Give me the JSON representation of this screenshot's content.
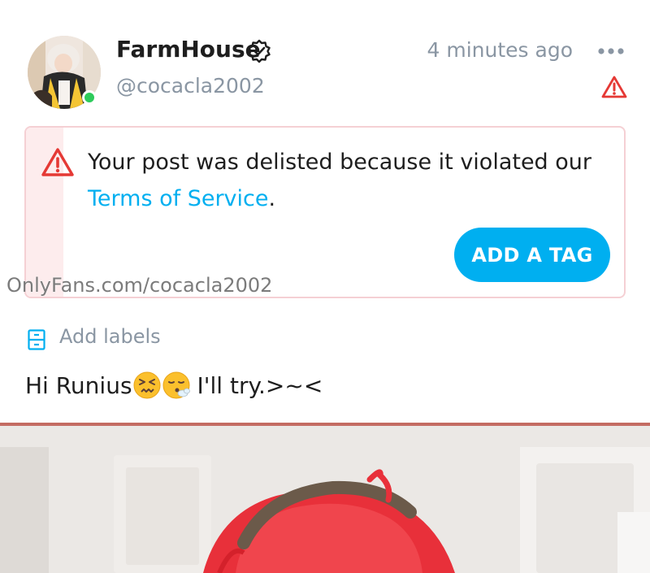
{
  "post": {
    "display_name": "FarmHouse",
    "username": "@cocacla2002",
    "timestamp": "4 minutes ago",
    "text": "Hi Runius",
    "text_suffix": "I'll try.>~<",
    "emojis": [
      "confounded-face-emoji",
      "face-exhaling-emoji"
    ]
  },
  "notice": {
    "message": "Your post was delisted because it violated our",
    "link_text": "Terms of Service",
    "link_suffix": ".",
    "button_label": "ADD A TAG"
  },
  "labels": {
    "add_label": "Add labels"
  },
  "watermark": "OnlyFans.com/cocacla2002",
  "colors": {
    "accent": "#00aff0",
    "warning": "#e53935",
    "muted_text": "#8a96a3",
    "online": "#2dcb5b"
  },
  "icons": [
    "verified-icon",
    "more-icon",
    "warning-icon",
    "labels-icon"
  ]
}
